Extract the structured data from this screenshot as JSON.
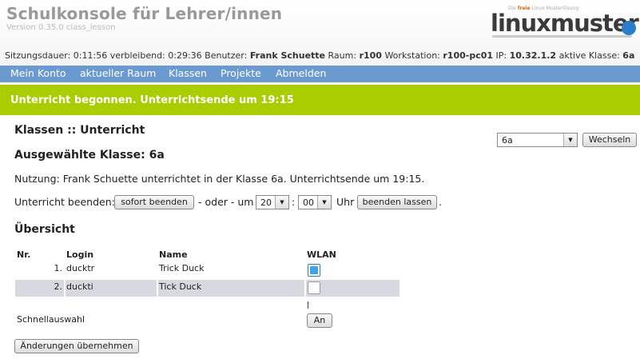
{
  "header": {
    "title": "Schulkonsole für Lehrer/innen",
    "version": "Version 0.35.0 class_lesson",
    "logo_tagline_prefix": "Die",
    "logo_tagline_em": "freie",
    "logo_tagline_suffix": "Linux Musterlösung",
    "logo_text": "linuxmuster",
    "logo_tail": ".n"
  },
  "session": {
    "duration_label": "Sitzungsdauer:",
    "duration": "0:11:56",
    "remaining_label": "verbleibend:",
    "remaining": "0:29:36",
    "user_label": "Benutzer:",
    "user": "Frank Schuette",
    "room_label": "Raum:",
    "room": "r100",
    "workstation_label": "Workstation:",
    "workstation": "r100-pc01",
    "ip_label": "IP:",
    "ip": "10.32.1.2",
    "class_label": "aktive Klasse:",
    "class": "6a"
  },
  "nav": {
    "items": [
      {
        "label": "Mein Konto"
      },
      {
        "label": "aktueller Raum"
      },
      {
        "label": "Klassen"
      },
      {
        "label": "Projekte"
      },
      {
        "label": "Abmelden"
      }
    ]
  },
  "banner": {
    "message": "Unterricht begonnen. Unterrichtsende um 19:15",
    "color": "#a8cd00"
  },
  "main": {
    "heading": "Klassen :: Unterricht",
    "class_select": {
      "selected": "6a"
    },
    "switch_button": "Wechseln",
    "selected_class_heading": "Ausgewählte Klasse: 6a",
    "usage_text": "Nutzung: Frank Schuette unterrichtet in der Klasse 6a. Unterrichtsende um 19:15.",
    "end_label": "Unterricht beenden:",
    "end_now_button": "sofort beenden",
    "or_label": "- oder - um",
    "hour_select": "20",
    "colon": ":",
    "minute_select": "00",
    "uhr_label": "Uhr",
    "end_later_button": "beenden lassen",
    "period": ".",
    "overview_heading": "Übersicht"
  },
  "table": {
    "headers": {
      "nr": "Nr.",
      "login": "Login",
      "name": "Name",
      "wlan": "WLAN"
    },
    "rows": [
      {
        "nr": "1.",
        "login": "ducktr",
        "name": "Trick Duck",
        "wlan_checked": true
      },
      {
        "nr": "2.",
        "login": "duckti",
        "name": "Tick Duck",
        "wlan_checked": false
      }
    ],
    "quick_select_label": "Schnellauswahl",
    "quick_on_button": "An"
  },
  "apply_button": "Änderungen übernehmen",
  "colors": {
    "nav_bg": "#6a9ad0",
    "banner_bg": "#a8cd00",
    "row_alt_bg": "#d8d8e0",
    "accent": "#3fa4e8"
  }
}
